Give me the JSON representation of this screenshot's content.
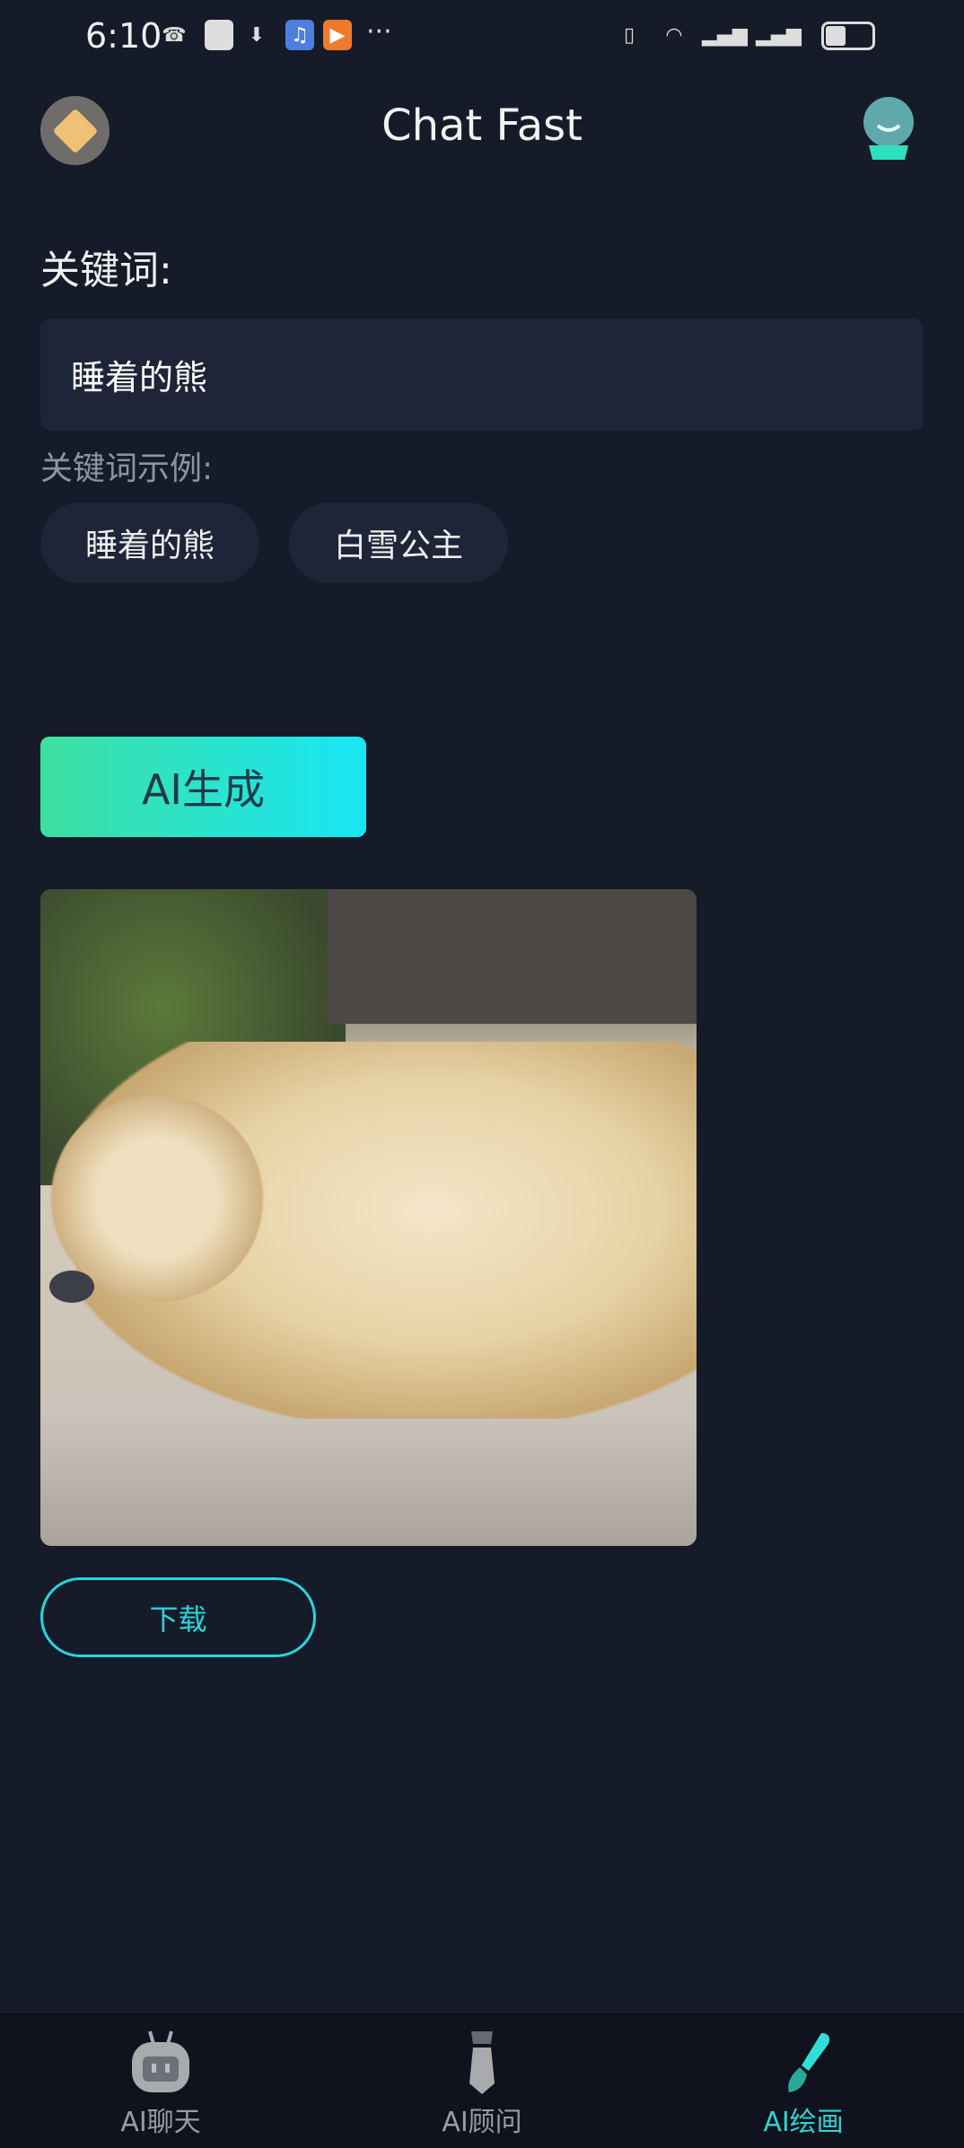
{
  "status_bar": {
    "time": "6:10",
    "more": "···"
  },
  "header": {
    "title": "Chat Fast"
  },
  "keyword": {
    "label": "关键词:",
    "value": "睡着的熊",
    "examples_label": "关键词示例:",
    "examples": [
      "睡着的熊",
      "白雪公主"
    ]
  },
  "generate_label": "AI生成",
  "download_label": "下载",
  "nav": {
    "items": [
      {
        "label": "AI聊天"
      },
      {
        "label": "AI顾问"
      },
      {
        "label": "AI绘画",
        "active": true
      }
    ]
  },
  "colors": {
    "accent": "#2fd1d8",
    "background": "#161b29",
    "input_bg": "#1f2538"
  }
}
